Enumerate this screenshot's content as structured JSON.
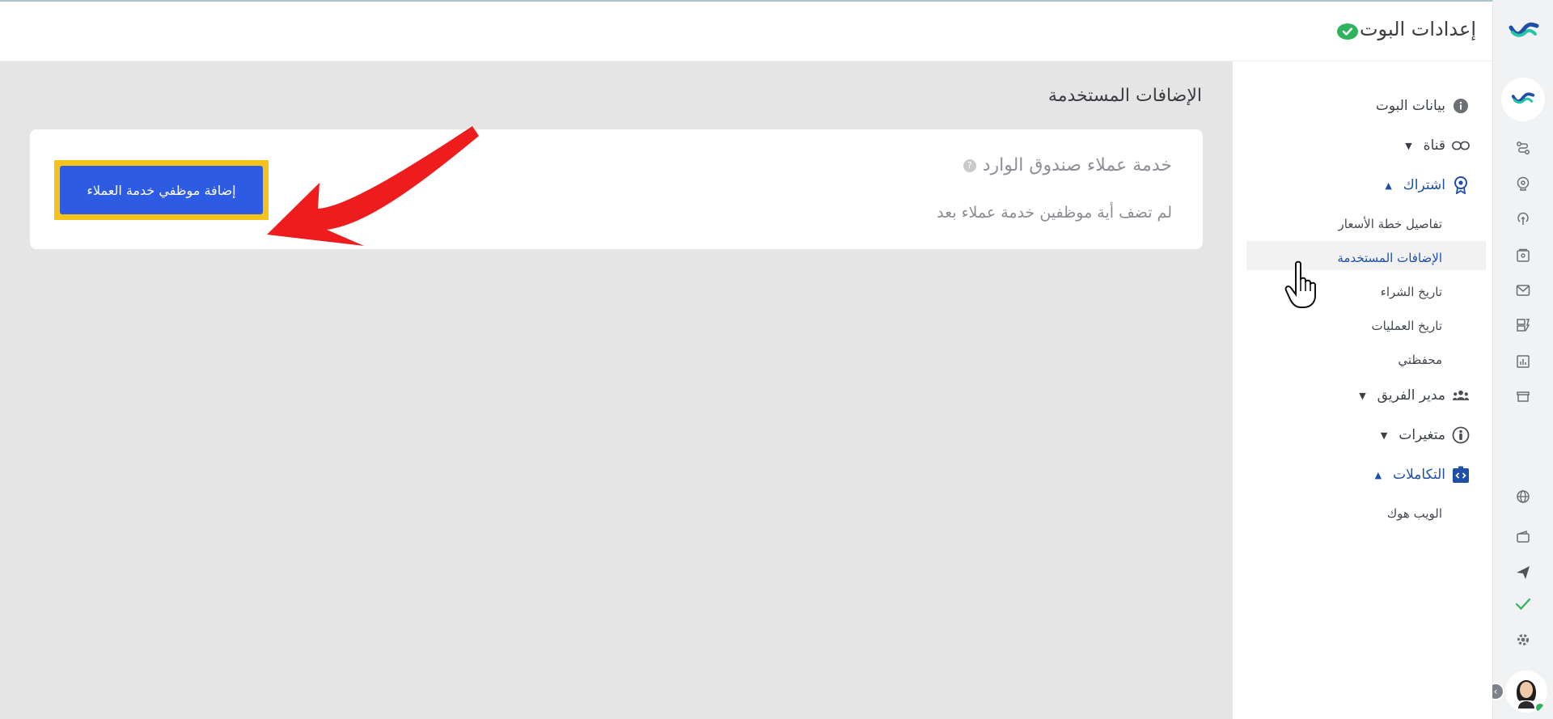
{
  "header": {
    "title": "إعدادات البوت"
  },
  "page": {
    "title": "الإضافات المستخدمة"
  },
  "card": {
    "title": "خدمة عملاء صندوق الوارد",
    "help": "?",
    "empty_text": "لم تضف أية موظفين خدمة عملاء بعد",
    "add_button_label": "إضافة موظفي خدمة العملاء"
  },
  "sidebar": {
    "items": [
      {
        "label": "بيانات البوت",
        "icon": "info-icon"
      },
      {
        "label": "قناة",
        "icon": "link-icon"
      },
      {
        "label": "اشتراك",
        "icon": "award-icon"
      },
      {
        "label": "مدير الفريق",
        "icon": "users-icon"
      },
      {
        "label": "متغيرات",
        "icon": "person-circle-icon"
      },
      {
        "label": "التكاملات",
        "icon": "code-icon"
      }
    ],
    "subscription_items": [
      {
        "label": "تفاصيل خطة الأسعار"
      },
      {
        "label": "الإضافات المستخدمة"
      },
      {
        "label": "تاريخ الشراء"
      },
      {
        "label": "تاريخ العمليات"
      },
      {
        "label": "محفظتي"
      }
    ],
    "integrations_items": [
      {
        "label": "الويب هوك"
      }
    ]
  },
  "colors": {
    "accent": "#2d5be3",
    "highlight": "#f5c21b",
    "arrow": "#ee1c1c",
    "active_nav": "#1f4fa8",
    "status_ok": "#2fb45d"
  }
}
